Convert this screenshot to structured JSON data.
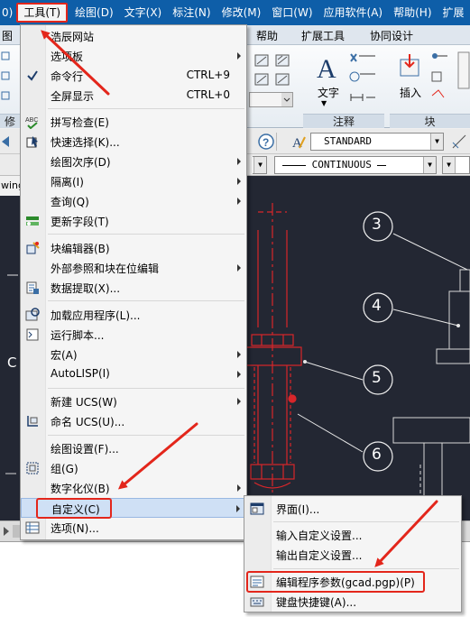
{
  "menubar": {
    "items": [
      {
        "label": "0)"
      },
      {
        "label": "工具(T)",
        "active": true
      },
      {
        "label": "绘图(D)"
      },
      {
        "label": "文字(X)"
      },
      {
        "label": "标注(N)"
      },
      {
        "label": "修改(M)"
      },
      {
        "label": "窗口(W)"
      },
      {
        "label": "应用软件(A)"
      },
      {
        "label": "帮助(H)"
      },
      {
        "label": "扩展"
      }
    ]
  },
  "ribbon": {
    "left_tab": "图",
    "tabs": [
      "帮助",
      "扩展工具",
      "协同设计"
    ],
    "left_panel_label": "修改",
    "panels": [
      {
        "label": "注释",
        "big_button": "文字"
      },
      {
        "label": "块",
        "big_button": "插入"
      }
    ]
  },
  "toolbar1": {
    "text_style": "STANDARD"
  },
  "toolbar2": {
    "linetype": "CONTINUOUS"
  },
  "doc_tab": "wing",
  "drawing": {
    "balloons": [
      "3",
      "4",
      "5",
      "6"
    ],
    "left_letter": "C"
  },
  "tools_menu": {
    "items": [
      {
        "label": "浩辰网站",
        "icon": "none"
      },
      {
        "label": "选项板",
        "icon": "none",
        "submenu": true
      },
      {
        "label": "命令行",
        "icon": "check-icon",
        "shortcut": "CTRL+9"
      },
      {
        "label": "全屏显示",
        "icon": "none",
        "shortcut": "CTRL+0"
      },
      {
        "label": "拼写检查(E)",
        "icon": "spellcheck-icon"
      },
      {
        "label": "快速选择(K)...",
        "icon": "quick-select-icon"
      },
      {
        "label": "绘图次序(D)",
        "icon": "none",
        "submenu": true
      },
      {
        "label": "隔离(I)",
        "icon": "none",
        "submenu": true
      },
      {
        "label": "查询(Q)",
        "icon": "none",
        "submenu": true
      },
      {
        "label": "更新字段(T)",
        "icon": "update-field-icon"
      },
      {
        "label": "块编辑器(B)",
        "icon": "block-editor-icon"
      },
      {
        "label": "外部参照和块在位编辑",
        "icon": "none",
        "submenu": true
      },
      {
        "label": "数据提取(X)...",
        "icon": "data-extract-icon"
      },
      {
        "label": "加载应用程序(L)...",
        "icon": "load-app-icon"
      },
      {
        "label": "运行脚本...",
        "icon": "script-icon"
      },
      {
        "label": "宏(A)",
        "icon": "none",
        "submenu": true
      },
      {
        "label": "AutoLISP(I)",
        "icon": "none",
        "submenu": true
      },
      {
        "label": "新建 UCS(W)",
        "icon": "none",
        "submenu": true
      },
      {
        "label": "命名 UCS(U)...",
        "icon": "named-ucs-icon"
      },
      {
        "label": "绘图设置(F)...",
        "icon": "none"
      },
      {
        "label": "组(G)",
        "icon": "group-icon"
      },
      {
        "label": "数字化仪(B)",
        "icon": "none",
        "submenu": true
      },
      {
        "label": "自定义(C)",
        "icon": "none",
        "submenu": true,
        "highlighted": true
      },
      {
        "label": "选项(N)...",
        "icon": "options-icon"
      }
    ]
  },
  "customize_submenu": {
    "items": [
      {
        "label": "界面(I)...",
        "icon": "interface-icon"
      },
      {
        "label": "输入自定义设置...",
        "icon": "none"
      },
      {
        "label": "输出自定义设置...",
        "icon": "none"
      },
      {
        "label": "编辑程序参数(gcad.pgp)(P)",
        "icon": "pgp-icon",
        "highlighted": true
      },
      {
        "label": "键盘快捷键(A)...",
        "icon": "keyboard-icon"
      }
    ]
  },
  "colors": {
    "menubar_bg": "#0e5ea8",
    "highlight_red": "#e3261b",
    "drawing_bg": "#232733",
    "cad_red": "#d8262a"
  }
}
